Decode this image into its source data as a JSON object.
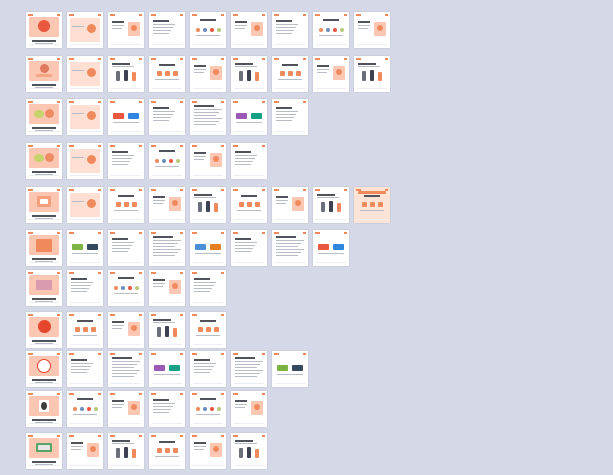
{
  "app": {
    "view": "slide-sorter"
  },
  "colors": {
    "background": "#d5d8e6",
    "slide": "#ffffff",
    "accent": "#f08a5d",
    "peach": "#fbc6b2",
    "red": "#e6462c",
    "text": "#50535c"
  },
  "rows": [
    {
      "count": 9
    },
    {
      "count": 9
    },
    {
      "count": 7
    },
    {
      "count": 6
    },
    {
      "count": 9
    },
    {
      "count": 8
    },
    {
      "count": 5
    },
    {
      "count": 5
    },
    {
      "count": 7
    },
    {
      "count": 6
    },
    {
      "count": 6
    }
  ]
}
